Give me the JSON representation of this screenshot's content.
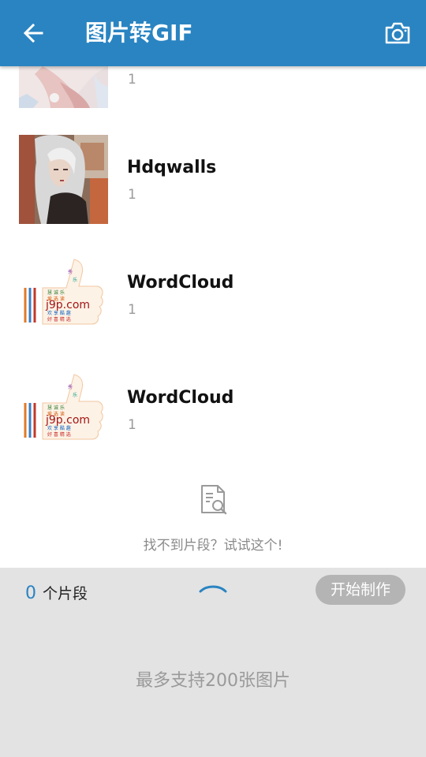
{
  "header": {
    "title": "图片转GIF",
    "back_icon": "arrow-left-icon",
    "camera_icon": "camera-icon",
    "background_color": "#2a84c2"
  },
  "albums": [
    {
      "name": "",
      "count": "1",
      "thumb": "photo-thumbnail"
    },
    {
      "name": "Hdqwalls",
      "count": "1",
      "thumb": "photo-thumbnail"
    },
    {
      "name": "WordCloud",
      "count": "1",
      "thumb": "wordcloud-thumbnail",
      "thumb_text": "j9p.com"
    },
    {
      "name": "WordCloud",
      "count": "1",
      "thumb": "wordcloud-thumbnail",
      "thumb_text": "j9p.com"
    }
  ],
  "empty_hint": {
    "icon": "document-search-icon",
    "text": "找不到片段？试试这个!"
  },
  "bottom_panel": {
    "count": "0",
    "count_unit": "个片段",
    "expand_icon": "chevron-up-icon",
    "start_button": "开始制作",
    "max_hint": "最多支持200张图片",
    "accent_color": "#2a84c2"
  }
}
